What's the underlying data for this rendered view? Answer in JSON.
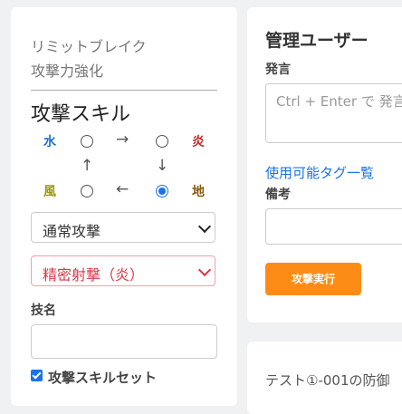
{
  "left": {
    "limit_break": "リミットブレイク",
    "atk_up": "攻撃力強化",
    "skill_title": "攻撃スキル",
    "elements": {
      "water": {
        "label": "水",
        "color": "#1f6fd1"
      },
      "fire": {
        "label": "炎",
        "color": "#c62828"
      },
      "wind": {
        "label": "風",
        "color": "#9a9a10"
      },
      "earth": {
        "label": "地",
        "color": "#8a5a10"
      }
    },
    "arrows": {
      "right": "→",
      "up": "↑",
      "down": "↓",
      "left": "←"
    },
    "selected_radio": "bottom-right",
    "attack_select": "通常攻撃",
    "precise_select": "精密射撃（炎）",
    "skill_name_label": "技名",
    "skill_name_value": "",
    "skill_set_label": "攻撃スキルセット",
    "skill_set_checked": true
  },
  "right": {
    "admin_title": "管理ユーザー",
    "speech_label": "発言",
    "speech_placeholder": "Ctrl + Enter で 発言",
    "tags_link": "使用可能タグ一覧",
    "notes_label": "備考",
    "notes_value": "",
    "execute_button": "攻撃実行",
    "log_text": "テスト①-001の防御"
  }
}
